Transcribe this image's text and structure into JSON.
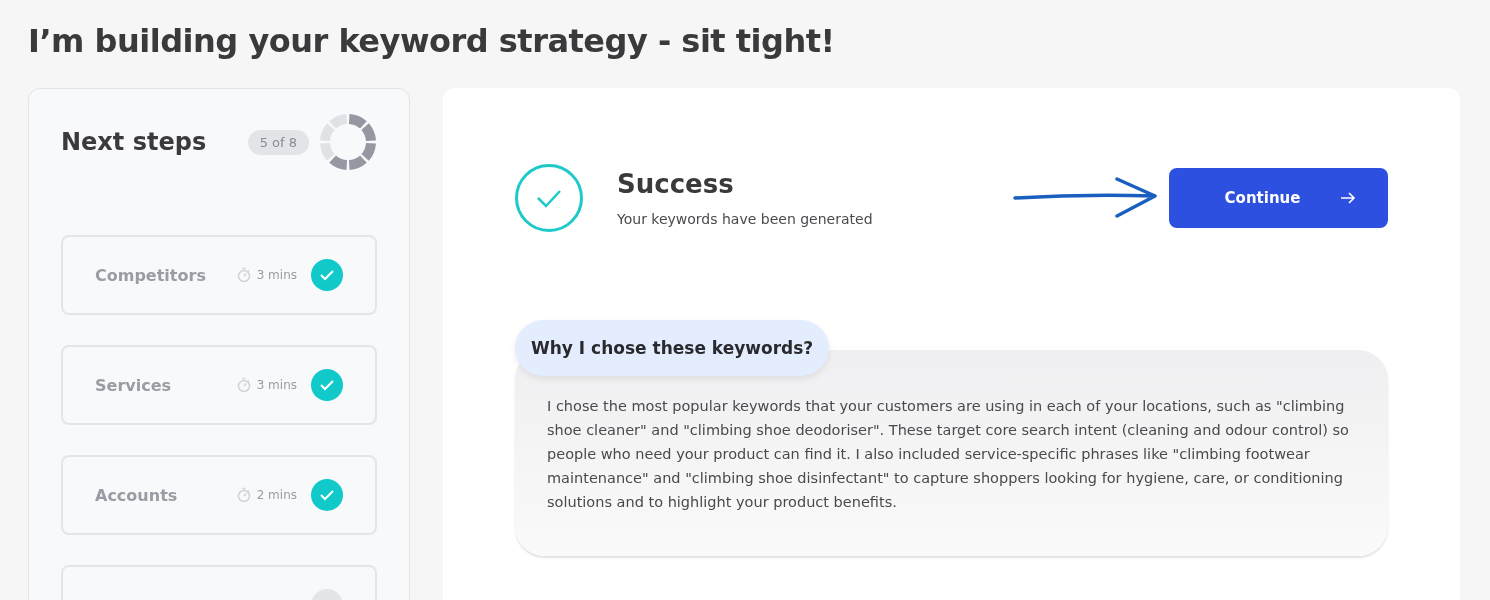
{
  "page_title": "I’m building your keyword strategy - sit tight!",
  "sidebar": {
    "title": "Next steps",
    "count": "5 of 8",
    "level": 0.625,
    "steps": [
      {
        "label": "Competitors",
        "duration": "3 mins",
        "done": true
      },
      {
        "label": "Services",
        "duration": "3 mins",
        "done": true
      },
      {
        "label": "Accounts",
        "duration": "2 mins",
        "done": true
      },
      {
        "done": false
      }
    ]
  },
  "status": {
    "title": "Success",
    "message": "Your keywords have been generated",
    "button": "Continue"
  },
  "explanation": {
    "title": "Why I chose these keywords?",
    "text": "I chose the most popular keywords that your customers are using in each of your locations, such as \"climbing shoe cleaner\" and \"climbing shoe deodoriser\". These target core search intent (cleaning and odour control) so people who need your product can find it. I also included service-specific phrases like \"climbing footwear maintenance\" and \"climbing shoe disinfectant\" to capture shoppers looking for hygiene, care, or conditioning solutions and to highlight your product benefits."
  }
}
